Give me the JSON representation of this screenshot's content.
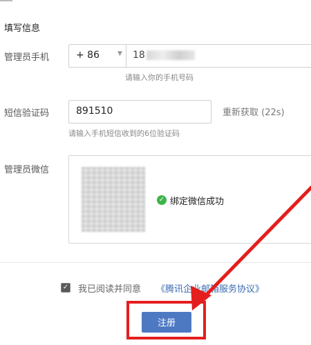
{
  "form": {
    "section_title": "填写信息",
    "phone": {
      "label": "管理员手机",
      "country_code": "+ 86",
      "value_prefix": "18",
      "hint": "请输入你的手机号码"
    },
    "sms": {
      "label": "短信验证码",
      "value": "891510",
      "resend_label": "重新获取 (22s)",
      "hint": "请输入手机短信收到的6位验证码"
    },
    "wechat": {
      "label": "管理员微信",
      "status": "绑定微信成功"
    },
    "agreement": {
      "checked": true,
      "text": "我已阅读并同意",
      "link": "《腾讯企业邮箱服务协议》"
    },
    "register_button": "注册"
  },
  "colors": {
    "accent": "#4d79c2",
    "link": "#3b6bb3",
    "success": "#3bb44a",
    "annotation": "#e41e1e"
  },
  "icons": {
    "caret": "caret-down-icon",
    "success": "check-circle-icon",
    "checkbox": "checkbox-checked-icon"
  }
}
